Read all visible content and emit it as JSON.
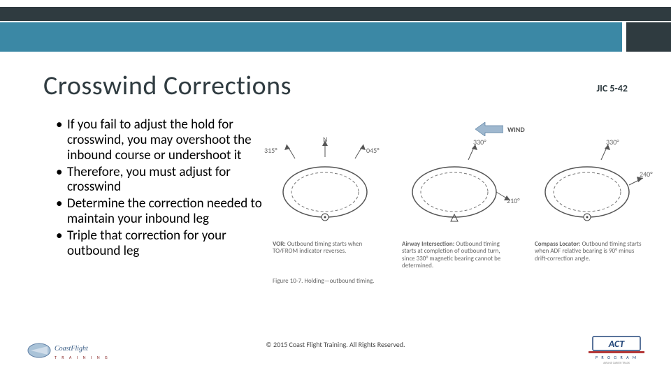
{
  "header": {
    "title": "Crosswind Corrections",
    "reference": "JIC 5-42"
  },
  "bullets": [
    "If you fail to adjust the hold for crosswind, you may overshoot the inbound course or undershoot it",
    "Therefore, you must adjust for crosswind",
    "Determine the correction needed to maintain your inbound leg",
    "Triple that correction for your outbound leg"
  ],
  "figure": {
    "wind_label": "WIND",
    "patterns": [
      {
        "top_left_label": "315°",
        "top_center_label": "N",
        "top_right_label": "045°",
        "caption_bold": "VOR:",
        "caption_rest": " Outbound timing starts when TO/FROM indicator reverses."
      },
      {
        "top_left_label": "",
        "top_center_label": "330°",
        "top_right_label": "",
        "side_label": "210°",
        "caption_bold": "Airway Intersection:",
        "caption_rest": " Outbound timing starts at completion of outbound turn, since 330° magnetic bearing cannot be determined."
      },
      {
        "top_left_label": "",
        "top_center_label": "330°",
        "top_right_label": "",
        "side_label": "240°",
        "caption_bold": "Compass Locator:",
        "caption_rest": " Outbound timing starts when ADF relative bearing is 90° minus drift-correction angle."
      }
    ],
    "figure_label": "Figure 10-7. Holding—outbound timing."
  },
  "footer": {
    "copyright": "© 2015 Coast Flight Training. All Rights Reserved.",
    "logo_left": "Coast Flight Training",
    "logo_right": "ACT Program"
  }
}
